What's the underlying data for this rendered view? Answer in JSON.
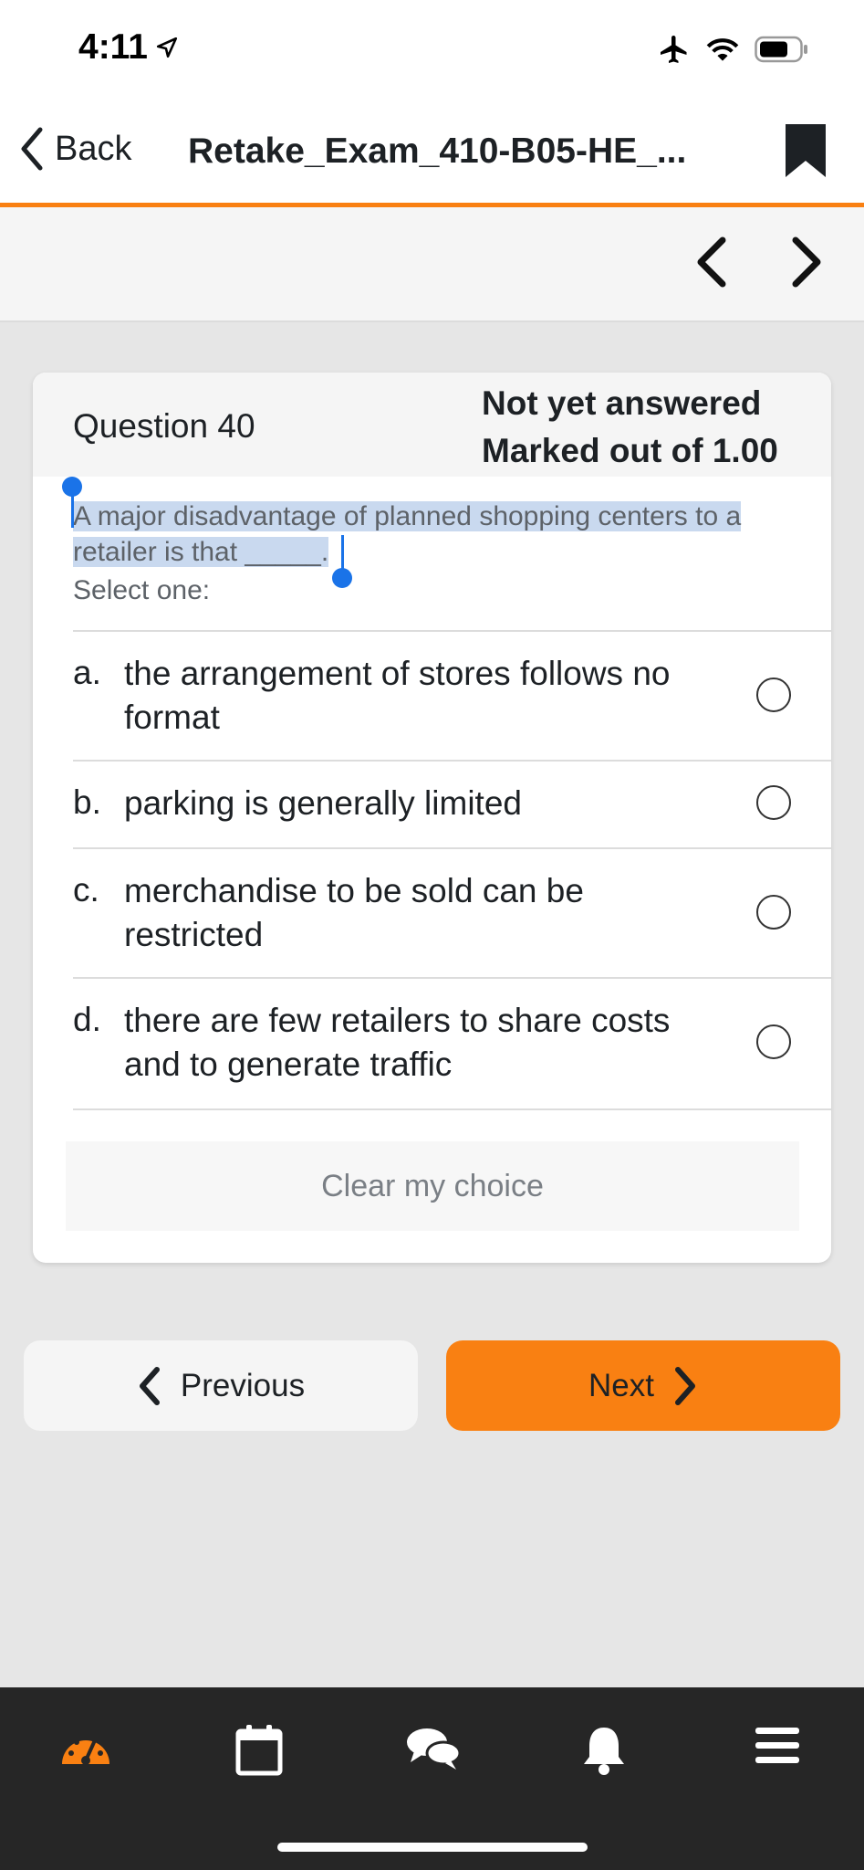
{
  "status": {
    "time": "4:11",
    "icons": [
      "location-arrow-icon",
      "airplane-icon",
      "wifi-icon",
      "battery-icon"
    ]
  },
  "navbar": {
    "back_label": "Back",
    "title": "Retake_Exam_410-B05-HE_..."
  },
  "question": {
    "number_label": "Question 40",
    "state": "Not yet answered",
    "mark": "Marked out of 1.00",
    "text_line1": "A major disadvantage of planned shopping centers to a",
    "text_line2": "retailer is that _____.",
    "select_label": "Select one:",
    "answers": [
      {
        "letter": "a.",
        "line1": "the arrangement of stores follows no",
        "line2": "format"
      },
      {
        "letter": "b.",
        "line1": "parking is generally limited",
        "line2": ""
      },
      {
        "letter": "c.",
        "line1": "merchandise to be sold can be",
        "line2": "restricted"
      },
      {
        "letter": "d.",
        "line1": "there are few retailers to share costs",
        "line2": "and to generate traffic"
      }
    ],
    "clear_label": "Clear my choice"
  },
  "navigation": {
    "previous_label": "Previous",
    "next_label": "Next"
  },
  "tabbar": {
    "items": [
      "dashboard-icon",
      "calendar-icon",
      "messages-icon",
      "notifications-icon",
      "menu-icon"
    ]
  },
  "colors": {
    "accent": "#f98012",
    "tabbar_bg": "#262626",
    "selection": "#c9d9ef",
    "selection_handle": "#1a73e8"
  }
}
